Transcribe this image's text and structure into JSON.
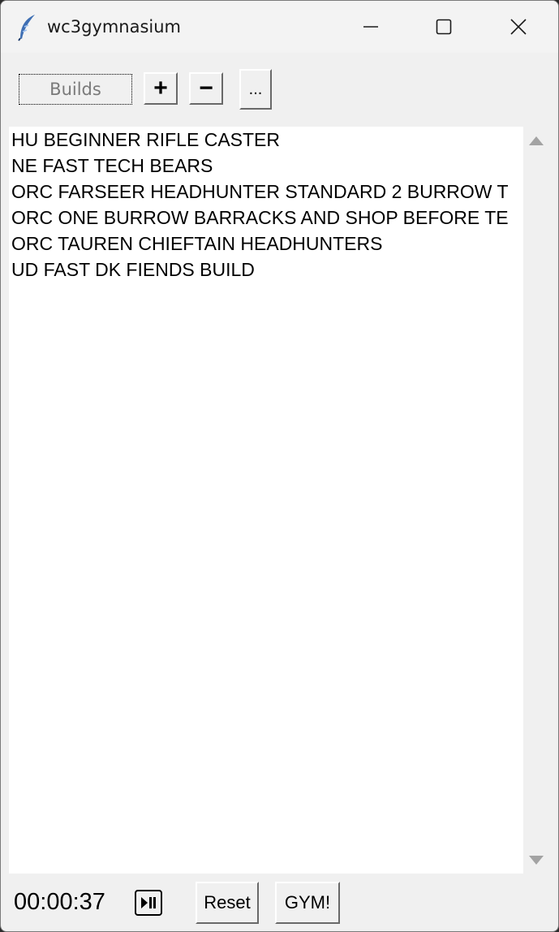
{
  "window": {
    "title": "wc3gymnasium",
    "app_icon": "feather-icon"
  },
  "toolbar": {
    "builds_label": "Builds",
    "add_label": "+",
    "remove_label": "−",
    "more_label": "..."
  },
  "builds": [
    "HU BEGINNER RIFLE CASTER",
    "NE FAST TECH BEARS",
    "ORC FARSEER HEADHUNTER STANDARD 2 BURROW T",
    "ORC ONE BURROW BARRACKS AND SHOP BEFORE TE",
    "ORC TAUREN CHIEFTAIN HEADHUNTERS",
    "UD FAST DK FIENDS BUILD"
  ],
  "footer": {
    "timer": "00:00:37",
    "play_pause_icon": "play-pause-icon",
    "reset_label": "Reset",
    "gym_label": "GYM!"
  }
}
